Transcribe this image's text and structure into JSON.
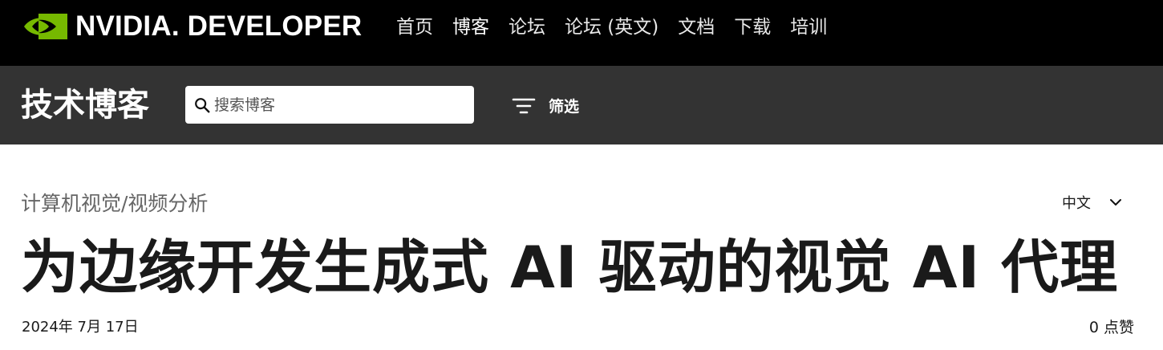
{
  "header": {
    "brand_text": "NVIDIA. DEVELOPER",
    "nav": [
      {
        "label": "首页"
      },
      {
        "label": "博客",
        "active": true
      },
      {
        "label": "论坛"
      },
      {
        "label": "论坛 (英文)"
      },
      {
        "label": "文档"
      },
      {
        "label": "下载"
      },
      {
        "label": "培训"
      }
    ],
    "brand_color": "#76B900"
  },
  "subheader": {
    "title": "技术博客",
    "search_placeholder": "搜索博客",
    "search_value": "",
    "filter_label": "筛选",
    "icons": {
      "search": "search-icon",
      "filter": "filter-icon"
    }
  },
  "article": {
    "category": "计算机视觉/视频分析",
    "language": "中文",
    "title": "为边缘开发生成式 AI 驱动的视觉 AI 代理",
    "date": "2024年 7月 17日",
    "likes": "0 点赞"
  }
}
